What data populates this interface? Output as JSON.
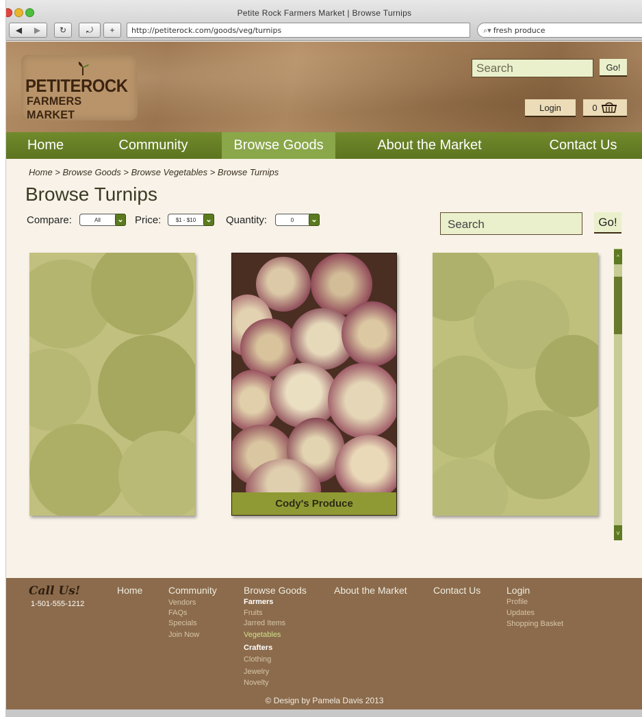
{
  "browser": {
    "window_title": "Petite Rock Farmers Market | Browse Turnips",
    "url": "http://petiterock.com/goods/veg/turnips",
    "search_value": "fresh produce",
    "back_icon": "back-arrow-icon",
    "forward_icon": "forward-arrow-icon",
    "reload_icon": "reload-icon",
    "add_icon": "plus-icon"
  },
  "logo": {
    "line1": "PETITEROCK",
    "line2": "FARMERS MARKET"
  },
  "header": {
    "search_placeholder": "Search",
    "go_label": "Go!",
    "login_label": "Login",
    "cart_count": "0"
  },
  "nav": {
    "items": [
      {
        "label": "Home"
      },
      {
        "label": "Community"
      },
      {
        "label": "Browse Goods"
      },
      {
        "label": "About the Market"
      },
      {
        "label": "Contact Us"
      }
    ],
    "active": "Browse Goods"
  },
  "breadcrumb": "Home > Browse Goods > Browse Vegetables > Browse Turnips",
  "page_title": "Browse Turnips",
  "filters": {
    "compare_label": "Compare:",
    "compare_value": "All",
    "price_label": "Price:",
    "price_value": "$1 - $10",
    "quantity_label": "Quantity:",
    "quantity_value": "0"
  },
  "content_search": {
    "placeholder": "Search",
    "go_label": "Go!"
  },
  "products": [
    {
      "name": "",
      "state": "faded"
    },
    {
      "name": "Cody's Produce",
      "state": "selected"
    },
    {
      "name": "",
      "state": "faded"
    }
  ],
  "footer": {
    "call_title": "Call Us!",
    "phone": "1-501-555-1212",
    "home": "Home",
    "community": {
      "title": "Community",
      "links": [
        "Vendors",
        "FAQs",
        "Specials",
        "Join Now"
      ]
    },
    "browse": {
      "title": "Browse Goods",
      "farmers_label": "Farmers",
      "farmers_links": [
        "Fruits",
        "Jarred Items",
        "Vegetables"
      ],
      "crafters_label": "Crafters",
      "crafters_links": [
        "Clothing",
        "Jewelry",
        "Novelty"
      ]
    },
    "about": "About the Market",
    "contact": "Contact Us",
    "login": {
      "title": "Login",
      "links": [
        "Profile",
        "Updates",
        "Shopping Basket"
      ]
    },
    "copyright": "© Design by Pamela Davis 2013"
  },
  "colors": {
    "nav_green": "#5d7420",
    "nav_active": "#8aa74a",
    "footer_brown": "#8b6b4c",
    "page_bg": "#f8f2e8",
    "input_bg": "#eaf0cb"
  }
}
